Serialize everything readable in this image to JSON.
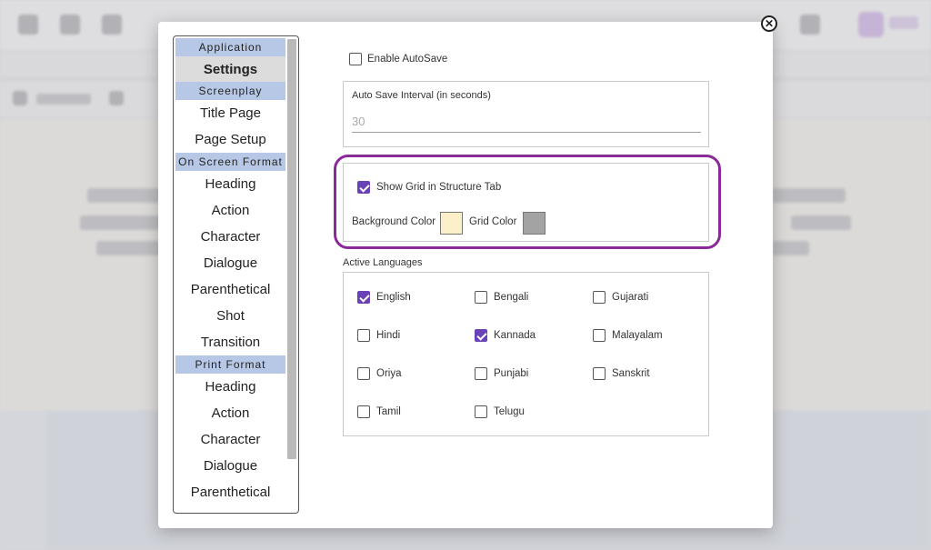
{
  "colors": {
    "accent": "#6a42b8",
    "highlight_ring": "#8a2a99",
    "nav_header_bg": "#b6c8e6",
    "background_color": "#fbf0c8",
    "grid_color": "#a3a3a3"
  },
  "dialog": {
    "close_icon": "close-icon"
  },
  "nav": {
    "application_header": "Application",
    "settings": "Settings",
    "screenplay_header": "Screenplay",
    "title_page": "Title Page",
    "page_setup": "Page Setup",
    "on_screen_header": "On Screen Format",
    "on_screen_items": [
      "Heading",
      "Action",
      "Character",
      "Dialogue",
      "Parenthetical",
      "Shot",
      "Transition"
    ],
    "print_header": "Print Format",
    "print_items": [
      "Heading",
      "Action",
      "Character",
      "Dialogue",
      "Parenthetical"
    ]
  },
  "settings": {
    "enable_autosave": {
      "label": "Enable AutoSave",
      "checked": false
    },
    "interval": {
      "label": "Auto Save Interval (in seconds)",
      "placeholder": "30"
    },
    "show_grid": {
      "label": "Show Grid in Structure Tab",
      "checked": true
    },
    "background_color_label": "Background Color",
    "grid_color_label": "Grid Color",
    "languages_title": "Active Languages",
    "languages": [
      {
        "name": "English",
        "checked": true
      },
      {
        "name": "Bengali",
        "checked": false
      },
      {
        "name": "Gujarati",
        "checked": false
      },
      {
        "name": "Hindi",
        "checked": false
      },
      {
        "name": "Kannada",
        "checked": true
      },
      {
        "name": "Malayalam",
        "checked": false
      },
      {
        "name": "Oriya",
        "checked": false
      },
      {
        "name": "Punjabi",
        "checked": false
      },
      {
        "name": "Sanskrit",
        "checked": false
      },
      {
        "name": "Tamil",
        "checked": false
      },
      {
        "name": "Telugu",
        "checked": false
      }
    ]
  }
}
